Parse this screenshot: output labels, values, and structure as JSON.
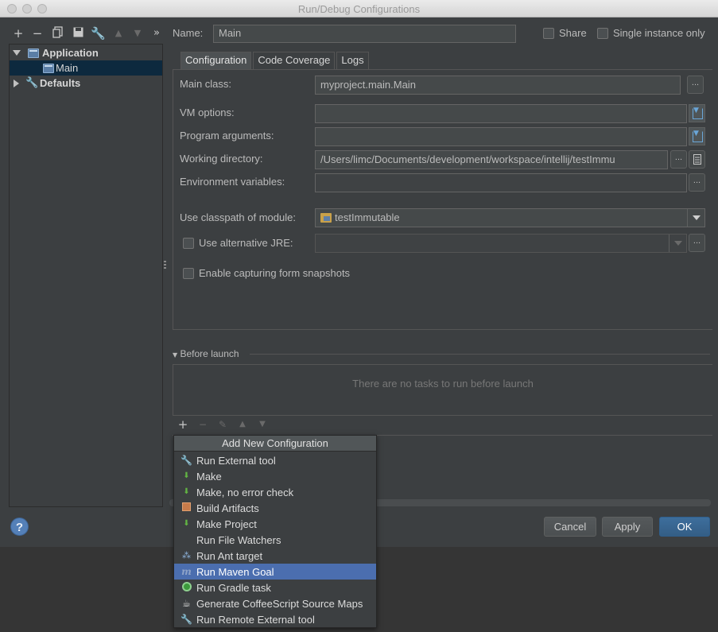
{
  "window": {
    "title": "Run/Debug Configurations"
  },
  "toolbar": {
    "add": "+",
    "remove": "−",
    "more": "»"
  },
  "tree": {
    "application_label": "Application",
    "main_label": "Main",
    "defaults_label": "Defaults"
  },
  "name": {
    "label": "Name:",
    "value": "Main"
  },
  "share": {
    "label": "Share"
  },
  "single_instance": {
    "label": "Single instance only"
  },
  "tabs": [
    "Configuration",
    "Code Coverage",
    "Logs"
  ],
  "form": {
    "main_class_label": "Main class:",
    "main_class_value": "myproject.main.Main",
    "vm_options_label": "VM options:",
    "program_args_label": "Program arguments:",
    "working_dir_label": "Working directory:",
    "working_dir_value": "/Users/limc/Documents/development/workspace/intellij/testImmu",
    "env_vars_label": "Environment variables:",
    "classpath_label": "Use classpath of module:",
    "classpath_value": "testImmutable",
    "alt_jre_label": "Use alternative JRE:",
    "snapshots_label": "Enable capturing form snapshots",
    "ellipsis": "..."
  },
  "before_launch": {
    "title": "Before launch",
    "empty_text": "There are no tasks to run before launch"
  },
  "buttons": {
    "help": "?",
    "cancel": "Cancel",
    "apply": "Apply",
    "ok": "OK"
  },
  "popup": {
    "title": "Add New Configuration",
    "items": [
      {
        "label": "Run External tool",
        "icon": "wrench-icon"
      },
      {
        "label": "Make",
        "icon": "make-icon"
      },
      {
        "label": "Make, no error check",
        "icon": "make-icon"
      },
      {
        "label": "Build Artifacts",
        "icon": "artifact-icon"
      },
      {
        "label": "Make Project",
        "icon": "make-icon"
      },
      {
        "label": "Run File Watchers",
        "icon": ""
      },
      {
        "label": "Run Ant target",
        "icon": "ant-icon"
      },
      {
        "label": "Run Maven Goal",
        "icon": "maven-icon",
        "selected": true
      },
      {
        "label": "Run Gradle task",
        "icon": "gradle-icon"
      },
      {
        "label": "Generate CoffeeScript Source Maps",
        "icon": "coffee-icon"
      },
      {
        "label": "Run Remote External tool",
        "icon": "wrench-icon"
      }
    ]
  },
  "colors": {
    "accent": "#4b6eaf",
    "background": "#3c3f41",
    "selection": "#0d293e"
  }
}
